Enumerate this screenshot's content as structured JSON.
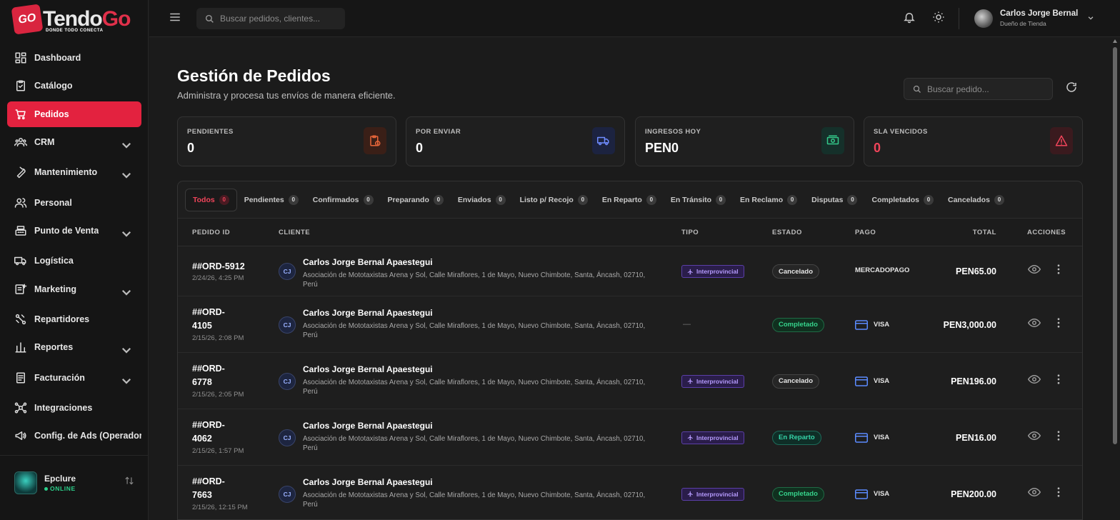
{
  "brand": {
    "name_part1": "Tendo",
    "name_part2": "Go",
    "badge": "GO",
    "tagline": "DONDE TODO CONECTA"
  },
  "sidebar": {
    "items": [
      {
        "label": "Dashboard",
        "icon": "dashboard-icon",
        "active": false,
        "expandable": false
      },
      {
        "label": "Catálogo",
        "icon": "clipboard-icon",
        "active": false,
        "expandable": false
      },
      {
        "label": "Pedidos",
        "icon": "cart-icon",
        "active": true,
        "expandable": false
      },
      {
        "label": "CRM",
        "icon": "users-icon",
        "active": false,
        "expandable": true
      },
      {
        "label": "Mantenimiento",
        "icon": "wrench-icon",
        "active": false,
        "expandable": true
      },
      {
        "label": "Personal",
        "icon": "people-icon",
        "active": false,
        "expandable": false
      },
      {
        "label": "Punto de Venta",
        "icon": "register-icon",
        "active": false,
        "expandable": true
      },
      {
        "label": "Logística",
        "icon": "truck-icon",
        "active": false,
        "expandable": false
      },
      {
        "label": "Marketing",
        "icon": "marketing-icon",
        "active": false,
        "expandable": true
      },
      {
        "label": "Repartidores",
        "icon": "route-icon",
        "active": false,
        "expandable": false
      },
      {
        "label": "Reportes",
        "icon": "bar-chart-icon",
        "active": false,
        "expandable": true
      },
      {
        "label": "Facturación",
        "icon": "invoice-icon",
        "active": false,
        "expandable": true
      },
      {
        "label": "Integraciones",
        "icon": "hub-icon",
        "active": false,
        "expandable": false
      },
      {
        "label": "Config. de Ads (Operador",
        "icon": "megaphone-icon",
        "active": false,
        "expandable": false
      }
    ],
    "footer": {
      "store_name": "Epclure",
      "status": "ONLINE"
    }
  },
  "topbar": {
    "search_placeholder": "Buscar pedidos, clientes...",
    "user_name": "Carlos Jorge Bernal",
    "user_role": "Dueño de Tienda"
  },
  "page": {
    "title": "Gestión de Pedidos",
    "subtitle": "Administra y procesa tus envíos de manera eficiente.",
    "search_placeholder": "Buscar pedido..."
  },
  "stats": [
    {
      "label": "PENDIENTES",
      "value": "0",
      "icon": "clipboard-clock-icon",
      "color": "#e8663a",
      "bg": "#3a1f17",
      "value_red": false
    },
    {
      "label": "POR ENVIAR",
      "value": "0",
      "icon": "truck-icon",
      "color": "#6f8cff",
      "bg": "#1c2340",
      "value_red": false
    },
    {
      "label": "INGRESOS HOY",
      "value": "PEN0",
      "icon": "cash-icon",
      "color": "#34c98a",
      "bg": "#15302a",
      "value_red": false
    },
    {
      "label": "SLA VENCIDOS",
      "value": "0",
      "icon": "warning-icon",
      "color": "#f0445a",
      "bg": "#3a1a1e",
      "value_red": true
    }
  ],
  "tabs": [
    {
      "label": "Todos",
      "count": "0",
      "active": true
    },
    {
      "label": "Pendientes",
      "count": "0",
      "active": false
    },
    {
      "label": "Confirmados",
      "count": "0",
      "active": false
    },
    {
      "label": "Preparando",
      "count": "0",
      "active": false
    },
    {
      "label": "Enviados",
      "count": "0",
      "active": false
    },
    {
      "label": "Listo p/ Recojo",
      "count": "0",
      "active": false
    },
    {
      "label": "En Reparto",
      "count": "0",
      "active": false
    },
    {
      "label": "En Tránsito",
      "count": "0",
      "active": false
    },
    {
      "label": "En Reclamo",
      "count": "0",
      "active": false
    },
    {
      "label": "Disputas",
      "count": "0",
      "active": false
    },
    {
      "label": "Completados",
      "count": "0",
      "active": false
    },
    {
      "label": "Cancelados",
      "count": "0",
      "active": false
    }
  ],
  "table": {
    "headers": {
      "id": "PEDIDO ID",
      "client": "CLIENTE",
      "tipo": "TIPO",
      "estado": "ESTADO",
      "pago": "PAGO",
      "total": "TOTAL",
      "acciones": "ACCIONES"
    },
    "rows": [
      {
        "id_line1": "##ORD-5912",
        "id_line2": "",
        "date": "2/24/26, 4:25 PM",
        "initials": "CJ",
        "client": "Carlos Jorge Bernal Apaestegui",
        "address": "Asociación de Mototaxistas Arena y Sol, Calle Miraflores, 1 de Mayo, Nuevo Chimbote, Santa, Áncash, 02710, Perú",
        "tipo": "Interprovincial",
        "estado": "Cancelado",
        "estado_class": "cancelado",
        "pago": "MERCADOPAGO",
        "pago_card": false,
        "total": "PEN65.00"
      },
      {
        "id_line1": "##ORD-",
        "id_line2": "4105",
        "date": "2/15/26, 2:08 PM",
        "initials": "CJ",
        "client": "Carlos Jorge Bernal Apaestegui",
        "address": "Asociación de Mototaxistas Arena y Sol, Calle Miraflores, 1 de Mayo, Nuevo Chimbote, Santa, Áncash, 02710, Perú",
        "tipo": "",
        "estado": "Completado",
        "estado_class": "completado",
        "pago": "VISA",
        "pago_card": true,
        "total": "PEN3,000.00"
      },
      {
        "id_line1": "##ORD-",
        "id_line2": "6778",
        "date": "2/15/26, 2:05 PM",
        "initials": "CJ",
        "client": "Carlos Jorge Bernal Apaestegui",
        "address": "Asociación de Mototaxistas Arena y Sol, Calle Miraflores, 1 de Mayo, Nuevo Chimbote, Santa, Áncash, 02710, Perú",
        "tipo": "Interprovincial",
        "estado": "Cancelado",
        "estado_class": "cancelado",
        "pago": "VISA",
        "pago_card": true,
        "total": "PEN196.00"
      },
      {
        "id_line1": "##ORD-",
        "id_line2": "4062",
        "date": "2/15/26, 1:57 PM",
        "initials": "CJ",
        "client": "Carlos Jorge Bernal Apaestegui",
        "address": "Asociación de Mototaxistas Arena y Sol, Calle Miraflores, 1 de Mayo, Nuevo Chimbote, Santa, Áncash, 02710, Perú",
        "tipo": "Interprovincial",
        "estado": "En Reparto",
        "estado_class": "reparto",
        "pago": "VISA",
        "pago_card": true,
        "total": "PEN16.00"
      },
      {
        "id_line1": "##ORD-",
        "id_line2": "7663",
        "date": "2/15/26, 12:15 PM",
        "initials": "CJ",
        "client": "Carlos Jorge Bernal Apaestegui",
        "address": "Asociación de Mototaxistas Arena y Sol, Calle Miraflores, 1 de Mayo, Nuevo Chimbote, Santa, Áncash, 02710, Perú",
        "tipo": "Interprovincial",
        "estado": "Completado",
        "estado_class": "completado",
        "pago": "VISA",
        "pago_card": true,
        "total": "PEN200.00"
      }
    ]
  }
}
